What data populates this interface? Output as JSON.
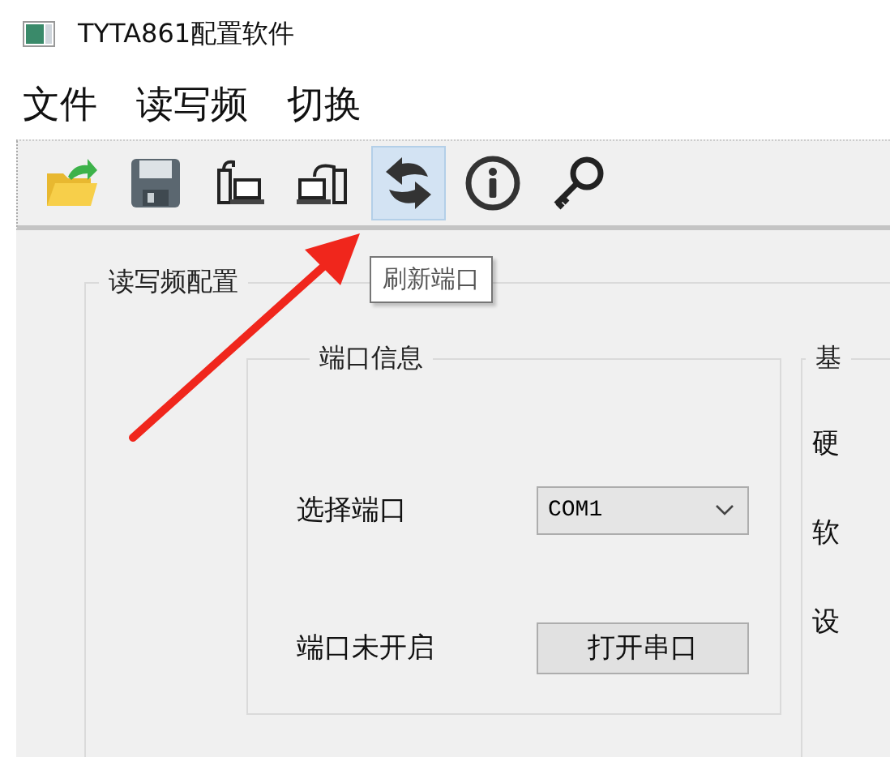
{
  "window": {
    "title": "TYTA861配置软件"
  },
  "menu": [
    {
      "label": "文件"
    },
    {
      "label": "读写频"
    },
    {
      "label": "切换"
    }
  ],
  "toolbar": [
    {
      "kind": "open",
      "highlighted": false
    },
    {
      "kind": "save",
      "highlighted": false
    },
    {
      "kind": "read",
      "highlighted": false
    },
    {
      "kind": "write",
      "highlighted": false
    },
    {
      "kind": "refresh",
      "highlighted": true
    },
    {
      "kind": "info",
      "highlighted": false
    },
    {
      "kind": "key",
      "highlighted": false
    }
  ],
  "tooltip": {
    "text": "刷新端口"
  },
  "config_group": {
    "title": "读写频配置",
    "port_group": {
      "title": "端口信息",
      "port_label": "选择端口",
      "port_select": {
        "value": "COM1"
      },
      "status": "端口未开启",
      "open_button": "打开串口"
    },
    "basic_group": {
      "title": "基",
      "labels": [
        "硬",
        "软",
        "设"
      ]
    }
  }
}
